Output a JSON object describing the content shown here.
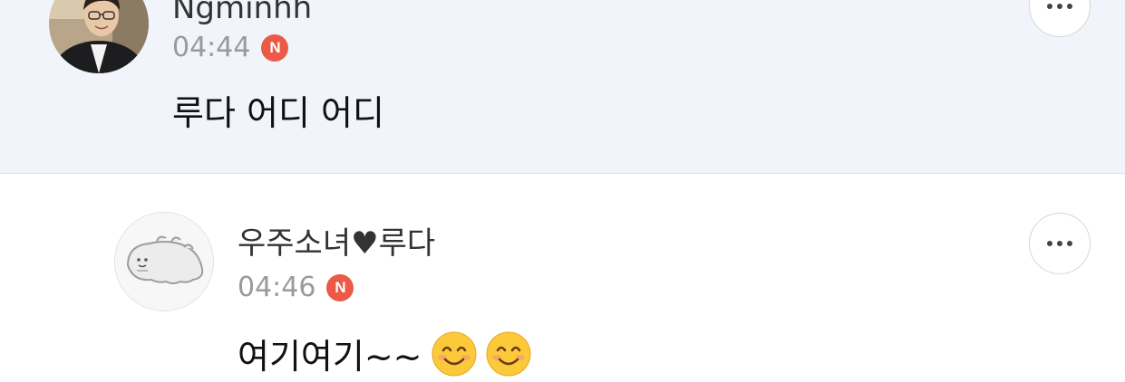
{
  "comments": [
    {
      "username": "Ngminhh",
      "time": "04:44",
      "badge": "N",
      "text": "루다 어디 어디",
      "emojis": []
    },
    {
      "username": "우주소녀♥루다",
      "time": "04:46",
      "badge": "N",
      "text": "여기여기~~",
      "emojis": [
        "smiling-face-emoji",
        "smiling-face-emoji"
      ]
    }
  ],
  "colors": {
    "highlight_background": "#f1f4fb",
    "badge": "#ea5a47",
    "time_text": "#9a9a9a"
  },
  "icons": {
    "more": "more-options-icon",
    "reply": "reply-arrow-icon"
  }
}
